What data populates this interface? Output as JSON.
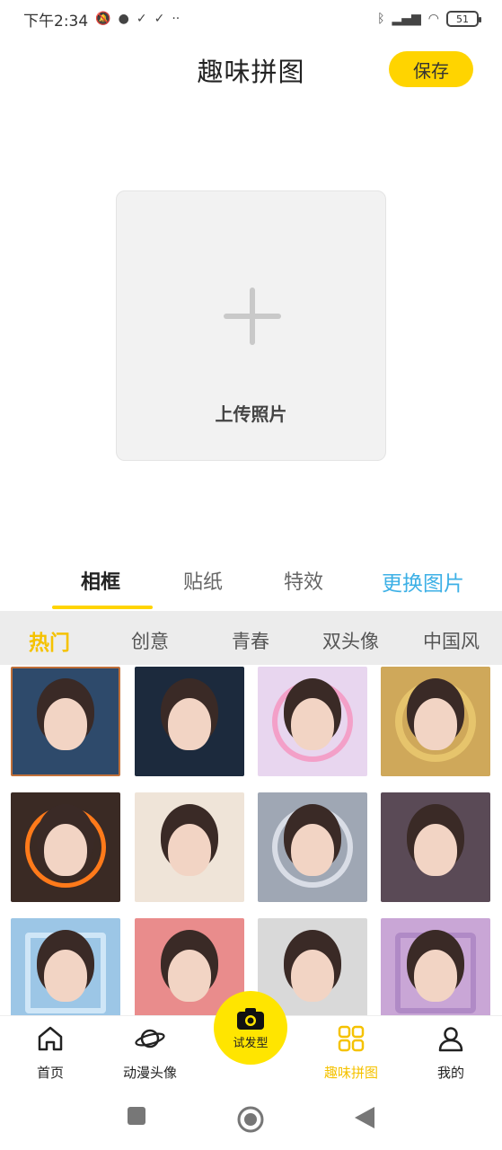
{
  "status_bar": {
    "time": "下午2:34",
    "battery": "51"
  },
  "header": {
    "title": "趣味拼图",
    "save_label": "保存"
  },
  "upload": {
    "label": "上传照片"
  },
  "main_tabs": [
    {
      "label": "相框",
      "active": true
    },
    {
      "label": "贴纸",
      "active": false
    },
    {
      "label": "特效",
      "active": false
    }
  ],
  "change_image_label": "更换图片",
  "categories": [
    {
      "label": "热门",
      "active": true
    },
    {
      "label": "创意",
      "active": false
    },
    {
      "label": "青春",
      "active": false
    },
    {
      "label": "双头像",
      "active": false
    },
    {
      "label": "中国风",
      "active": false
    }
  ],
  "templates": [
    {
      "name": "frame-photo-1",
      "bg": "#2e4a6b"
    },
    {
      "name": "frame-photo-2",
      "bg": "#1c2a3d"
    },
    {
      "name": "frame-photo-3",
      "bg": "#e8d6ef"
    },
    {
      "name": "frame-photo-4",
      "bg": "#cfa85a"
    },
    {
      "name": "frame-photo-5",
      "bg": "#3a2a24"
    },
    {
      "name": "frame-photo-6",
      "bg": "#efe4d8"
    },
    {
      "name": "frame-photo-7",
      "bg": "#9fa7b4"
    },
    {
      "name": "frame-photo-8",
      "bg": "#5a4a56"
    },
    {
      "name": "frame-photo-9",
      "bg": "#9cc6e6"
    },
    {
      "name": "frame-photo-10",
      "bg": "#e98c8c"
    },
    {
      "name": "frame-photo-11",
      "bg": "#d9d9d9"
    },
    {
      "name": "frame-photo-12",
      "bg": "#c9a6d6"
    }
  ],
  "bottom_nav": {
    "home": "首页",
    "anime_avatar": "动漫头像",
    "camera": "试发型",
    "fun_collage": "趣味拼图",
    "mine": "我的"
  },
  "colors": {
    "accent": "#ffd400",
    "link": "#3db0e6",
    "active_label": "#f5c200"
  }
}
